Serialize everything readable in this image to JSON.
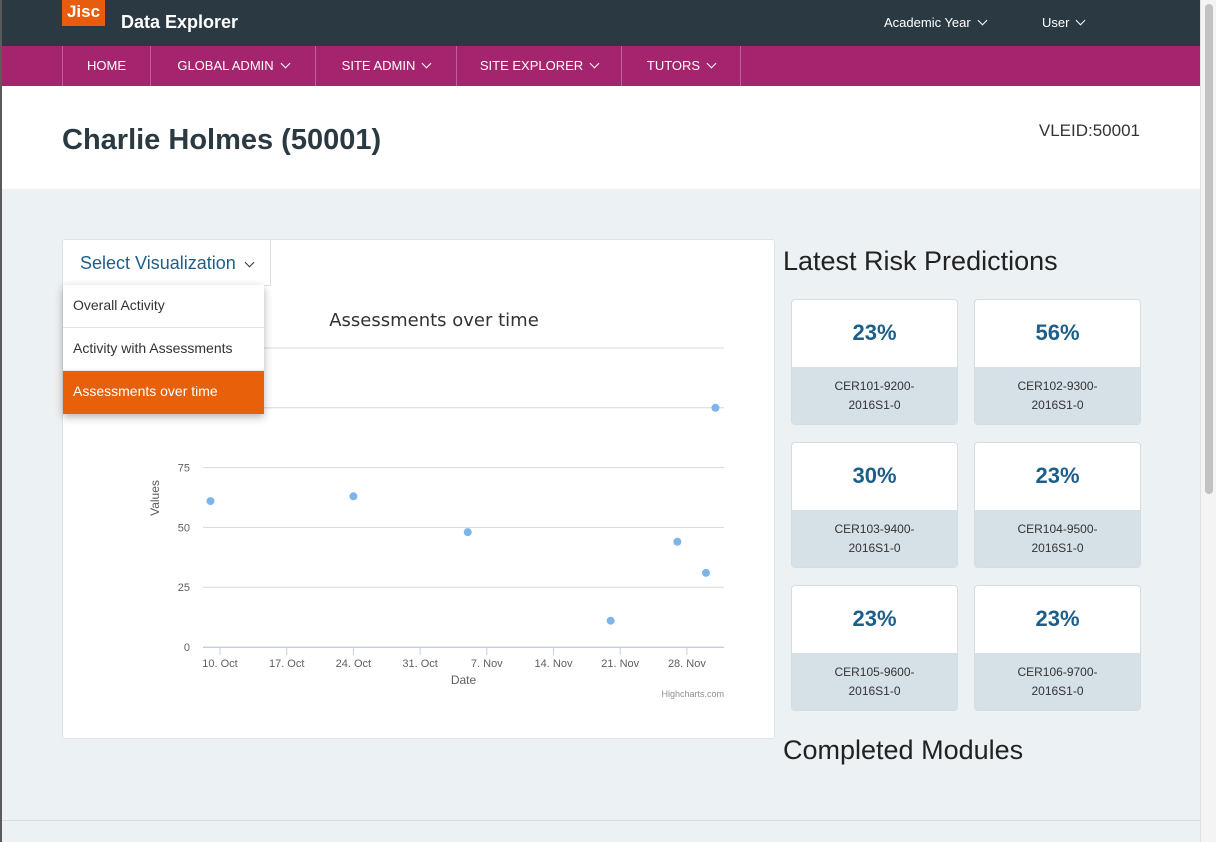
{
  "topbar": {
    "logo": "Jisc",
    "app_title": "Data Explorer",
    "academic_year": "Academic Year",
    "user": "User"
  },
  "nav": [
    "HOME",
    "GLOBAL ADMIN",
    "SITE ADMIN",
    "SITE EXPLORER",
    "TUTORS"
  ],
  "header": {
    "title": "Charlie Holmes (50001)",
    "vleid": "VLEID:50001"
  },
  "viz": {
    "select_label": "Select Visualization",
    "options": [
      "Overall Activity",
      "Activity with Assessments",
      "Assessments over time"
    ],
    "selected": "Assessments over time"
  },
  "chart_data": {
    "type": "scatter",
    "title": "Assessments over time",
    "xlabel": "Date",
    "ylabel": "Values",
    "x_ticks": [
      "10. Oct",
      "17. Oct",
      "24. Oct",
      "31. Oct",
      "7. Nov",
      "14. Nov",
      "21. Nov",
      "28. Nov"
    ],
    "y_ticks": [
      "0",
      "25",
      "50",
      "75",
      "100"
    ],
    "ylim": [
      0,
      125
    ],
    "credits": "Highcharts.com",
    "series": [
      {
        "color": "#7cb5ec",
        "points": [
          {
            "x": "2016-10-09",
            "y": 61
          },
          {
            "x": "2016-10-24",
            "y": 63
          },
          {
            "x": "2016-11-05",
            "y": 48
          },
          {
            "x": "2016-11-20",
            "y": 11
          },
          {
            "x": "2016-11-27",
            "y": 44
          },
          {
            "x": "2016-11-30",
            "y": 31
          },
          {
            "x": "2016-12-01",
            "y": 100
          }
        ]
      }
    ]
  },
  "risk": {
    "title": "Latest Risk Predictions",
    "cards": [
      {
        "pct": "23%",
        "code": "CER101-9200-2016S1-0"
      },
      {
        "pct": "56%",
        "code": "CER102-9300-2016S1-0"
      },
      {
        "pct": "30%",
        "code": "CER103-9400-2016S1-0"
      },
      {
        "pct": "23%",
        "code": "CER104-9500-2016S1-0"
      },
      {
        "pct": "23%",
        "code": "CER105-9600-2016S1-0"
      },
      {
        "pct": "23%",
        "code": "CER106-9700-2016S1-0"
      }
    ]
  },
  "completed": {
    "title": "Completed Modules"
  }
}
